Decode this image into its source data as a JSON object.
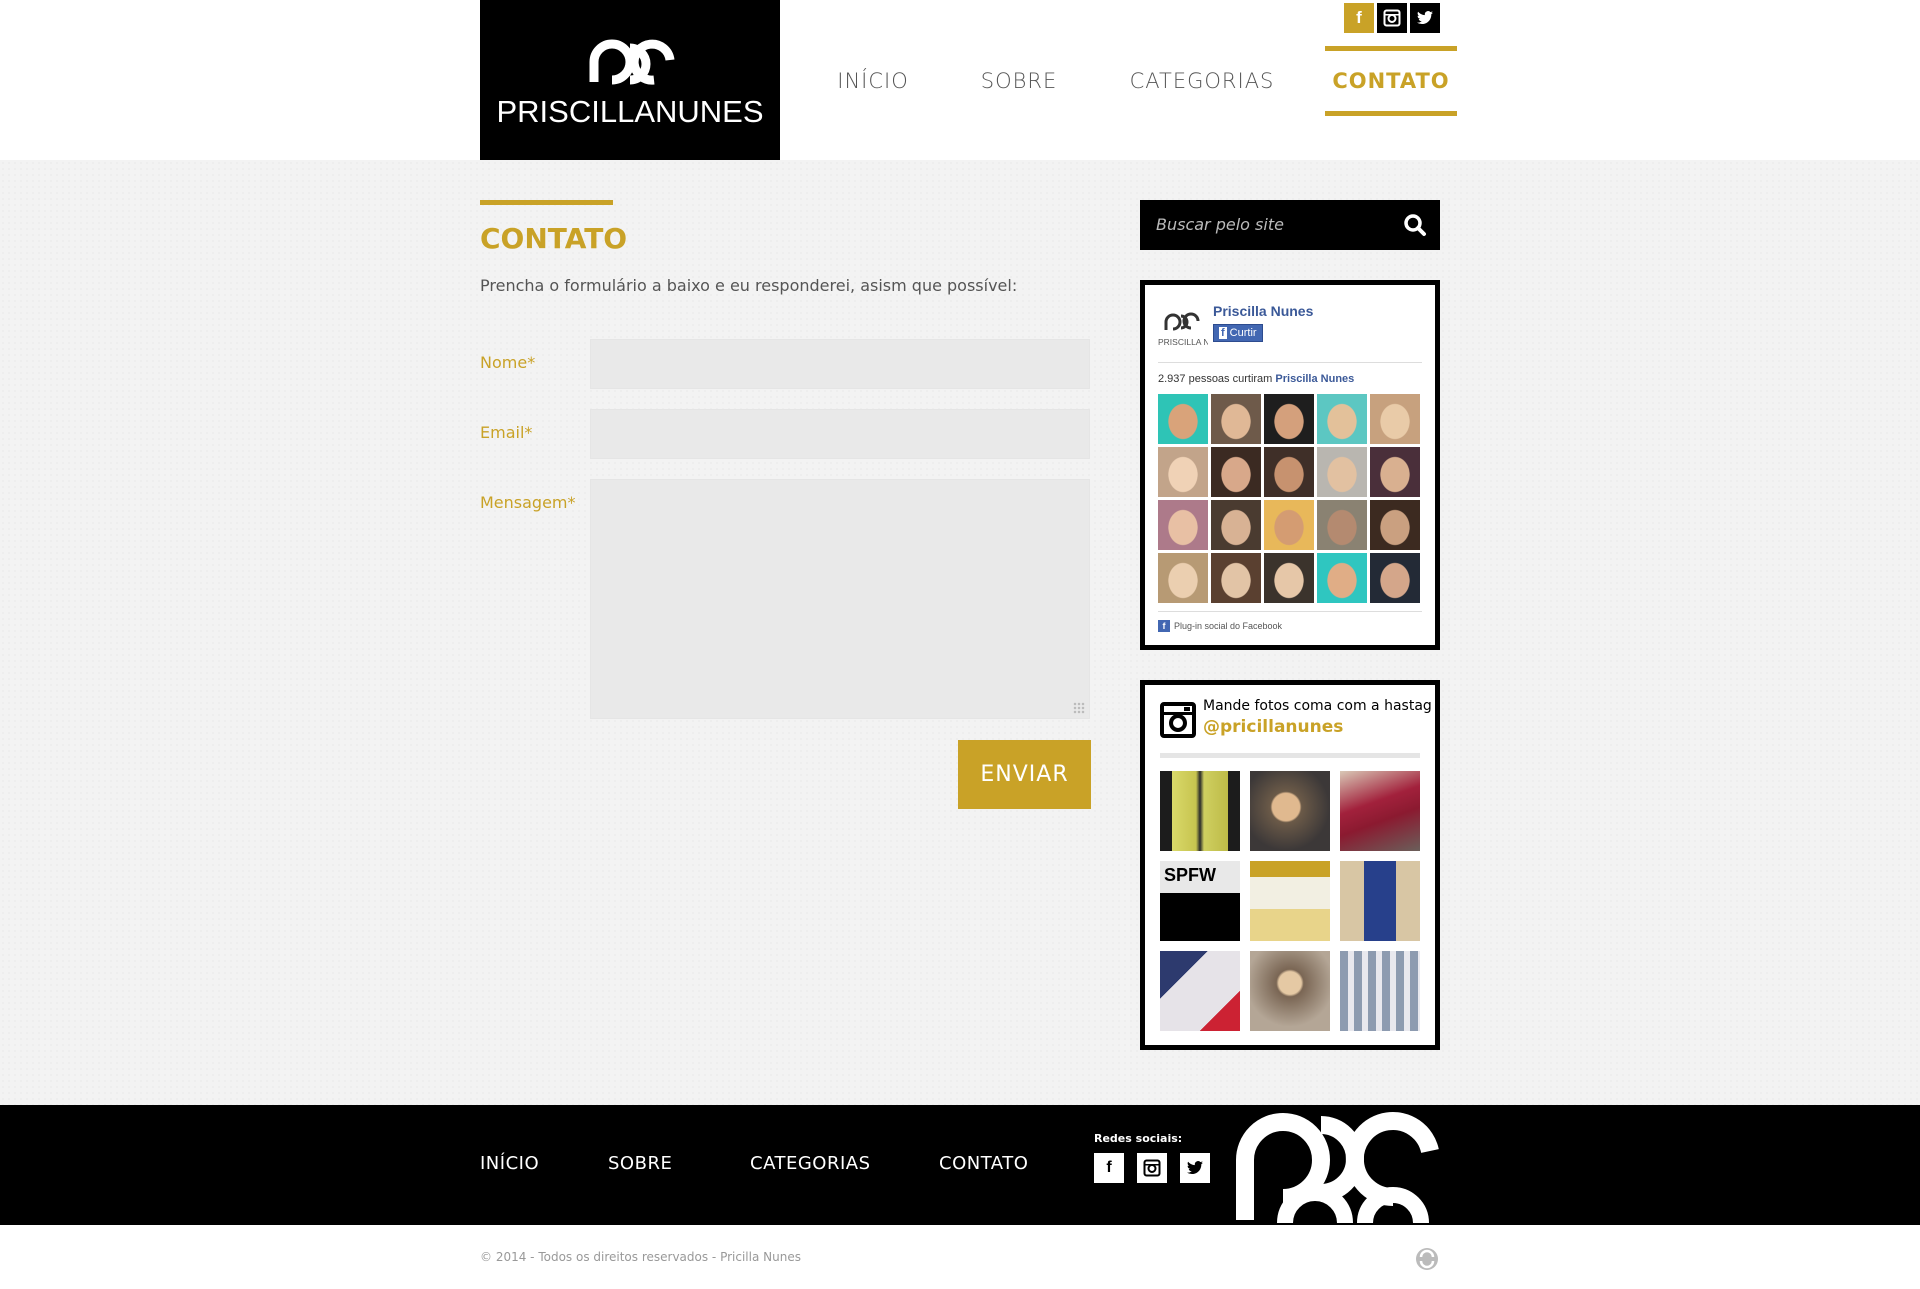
{
  "logo": {
    "text": "PRISCILLANUNES"
  },
  "header_social": [
    {
      "icon": "facebook-icon",
      "glyph": "f",
      "color": "#c9a227"
    },
    {
      "icon": "instagram-icon",
      "glyph": "◙",
      "color": "#000000"
    },
    {
      "icon": "twitter-icon",
      "glyph": "t",
      "color": "#000000"
    }
  ],
  "nav": {
    "items": [
      {
        "label": "INÍCIO"
      },
      {
        "label": "SOBRE"
      },
      {
        "label": "CATEGORIAS"
      },
      {
        "label": "CONTATO",
        "active": true
      }
    ]
  },
  "page": {
    "title": "CONTATO",
    "intro": "Prencha o formulário a baixo e eu responderei, asism que possível:"
  },
  "form": {
    "name_label": "Nome*",
    "email_label": "Email*",
    "message_label": "Mensagem*",
    "name_value": "",
    "email_value": "",
    "message_value": "",
    "submit_label": "ENVIAR"
  },
  "search": {
    "placeholder": "Buscar pelo site"
  },
  "facebook": {
    "page_name": "Priscilla Nunes",
    "logo_text": "PRISCILLA NUNES",
    "like_label": "Curtir",
    "count_text": "2.937 pessoas curtiram",
    "count_link": "Priscilla Nunes",
    "plugin_text": "Plug-in social do Facebook",
    "faces": 20
  },
  "instagram": {
    "title": "Mande fotos coma com a hastag",
    "tag": "@pricillanunes",
    "photos": [
      {
        "caption": ""
      },
      {
        "caption": ""
      },
      {
        "caption": ""
      },
      {
        "caption": "SPFW"
      },
      {
        "caption": ""
      },
      {
        "caption": ""
      },
      {
        "caption": ""
      },
      {
        "caption": ""
      },
      {
        "caption": ""
      }
    ]
  },
  "footer": {
    "nav": [
      "INÍCIO",
      "SOBRE",
      "CATEGORIAS",
      "CONTATO"
    ],
    "social_label": "Redes sociais:",
    "social": [
      {
        "icon": "facebook-icon",
        "glyph": "f"
      },
      {
        "icon": "instagram-icon",
        "glyph": "◙"
      },
      {
        "icon": "twitter-icon",
        "glyph": "t"
      }
    ],
    "copyright": "© 2014 - Todos os direitos reservados - Pricilla Nunes"
  },
  "colors": {
    "accent": "#c9a227",
    "dark": "#000000",
    "field": "#e9e9e9"
  }
}
